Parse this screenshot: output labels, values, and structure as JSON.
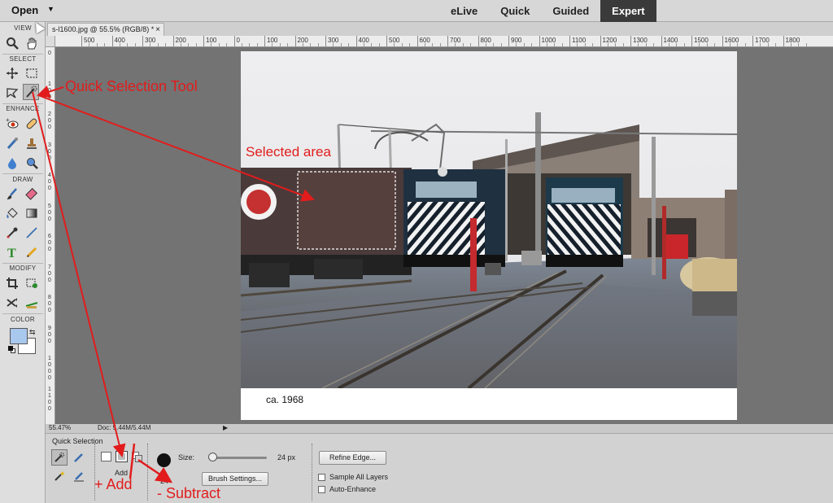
{
  "topbar": {
    "open_label": "Open",
    "modes": [
      {
        "label": "eLive",
        "active": false
      },
      {
        "label": "Quick",
        "active": false
      },
      {
        "label": "Guided",
        "active": false
      },
      {
        "label": "Expert",
        "active": true
      }
    ]
  },
  "document_tab": {
    "title": "s-l1600.jpg @ 55.5% (RGB/8) *",
    "close": "×"
  },
  "toolbar": {
    "sections": [
      "VIEW",
      "SELECT",
      "ENHANCE",
      "DRAW",
      "MODIFY",
      "COLOR"
    ],
    "tools": [
      "zoom-tool",
      "hand-tool",
      "move-tool",
      "marquee-tool",
      "lasso-tool",
      "quick-selection-tool",
      "red-eye-tool",
      "spot-healing-tool",
      "smart-brush-tool",
      "clone-stamp-tool",
      "blur-tool",
      "sponge-tool",
      "brush-tool",
      "eraser-tool",
      "paint-bucket-tool",
      "gradient-tool",
      "eyedropper-tool",
      "line-tool",
      "type-tool",
      "pencil-tool",
      "crop-tool",
      "recompose-tool",
      "content-aware-move-tool",
      "straighten-tool"
    ],
    "selected_tool": "quick-selection-tool",
    "foreground_color": "#a8c8ee",
    "background_color": "#ffffff"
  },
  "ruler": {
    "top_labels": [
      "500",
      "400",
      "300",
      "200",
      "100",
      "0",
      "100",
      "200",
      "300",
      "400",
      "500",
      "600",
      "700",
      "800",
      "900",
      "1000",
      "1100",
      "1200",
      "1300",
      "1400",
      "1500",
      "1600",
      "1700",
      "1800"
    ],
    "left_labels": [
      "0",
      "1 0 0",
      "2 0 0",
      "3 0 0",
      "4 0 0",
      "5 0 0",
      "6 0 0",
      "7 0 0",
      "8 0 0",
      "9 0 0",
      "1 0 0 0",
      "1 1 0 0"
    ]
  },
  "image": {
    "caption": "ca. 1968"
  },
  "status": {
    "zoom": "55.47%",
    "doc": "Doc: 5.44M/5.44M",
    "arrow": "▶"
  },
  "options": {
    "title": "Quick Selection",
    "mode_label": "Add",
    "size_label": "Size:",
    "size_value": "24 px",
    "brush_size_small": "24",
    "brush_settings_label": "Brush Settings...",
    "refine_edge_label": "Refine Edge...",
    "sample_all_layers_label": "Sample All Layers",
    "auto_enhance_label": "Auto-Enhance"
  },
  "annotations": {
    "quick_selection_tool": "Quick Selection Tool",
    "selected_area": "Selected area",
    "add": "+ Add",
    "subtract": "- Subtract",
    "color": "#e21c1c"
  }
}
